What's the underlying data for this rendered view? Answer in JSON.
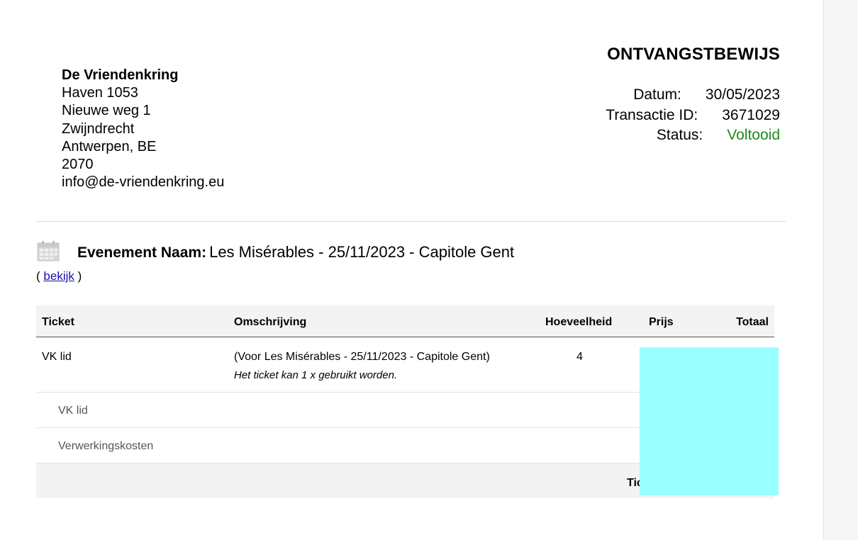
{
  "organization": {
    "name": "De Vriendenkring",
    "address_lines": [
      "Haven 1053",
      "Nieuwe weg 1",
      "Zwijndrecht",
      "Antwerpen, BE",
      "2070",
      "info@de-vriendenkring.eu"
    ]
  },
  "receipt": {
    "title": "ONTVANGSTBEWIJS",
    "date_label": "Datum:",
    "date_value": "30/05/2023",
    "transaction_label": "Transactie ID:",
    "transaction_value": "3671029",
    "status_label": "Status:",
    "status_value": "Voltooid",
    "status_color": "#1e8a1e"
  },
  "event": {
    "icon": "calendar-icon",
    "label": "Evenement Naam:",
    "value": "Les Misérables - 25/11/2023 - Capitole Gent",
    "view_open": "(",
    "view_link": "bekijk",
    "view_close": ")"
  },
  "table": {
    "headers": {
      "ticket": "Ticket",
      "description": "Omschrijving",
      "quantity": "Hoeveelheid",
      "price": "Prijs",
      "total": "Totaal"
    },
    "main_row": {
      "ticket": "VK lid",
      "description": "(Voor Les Misérables - 25/11/2023 - Capitole Gent)",
      "note": "Het ticket kan 1 x gebruikt worden.",
      "quantity": "4"
    },
    "sub_rows": [
      "VK lid",
      "Verwerkingskosten"
    ],
    "footer_label": "Tic"
  },
  "redaction_color": "#99ffff"
}
